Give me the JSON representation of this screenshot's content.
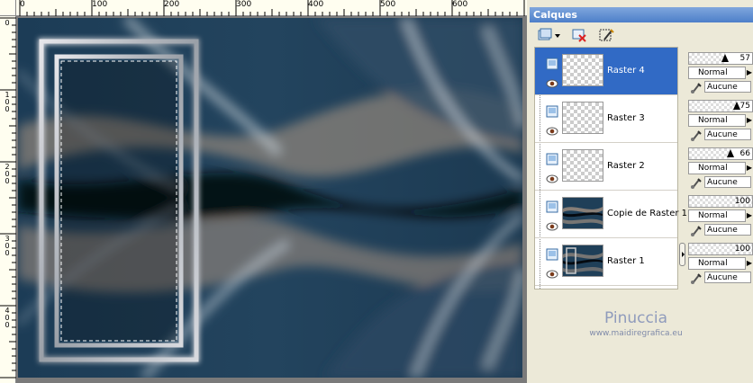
{
  "ruler": {
    "top_labels": [
      "0",
      "100",
      "200",
      "300",
      "400",
      "500",
      "600"
    ],
    "left_labels": [
      "0",
      "100",
      "200",
      "300",
      "400"
    ]
  },
  "panel": {
    "title": "Calques"
  },
  "layers": [
    {
      "name": "Raster 4",
      "selected": true,
      "opacity": "57",
      "opacity_value": 57,
      "blend": "Normal",
      "group": "Aucune"
    },
    {
      "name": "Raster 3",
      "selected": false,
      "opacity": "75",
      "opacity_value": 75,
      "blend": "Normal",
      "group": "Aucune"
    },
    {
      "name": "Raster 2",
      "selected": false,
      "opacity": "66",
      "opacity_value": 66,
      "blend": "Normal",
      "group": "Aucune"
    },
    {
      "name": "Copie de Raster 1",
      "selected": false,
      "opacity": "100",
      "opacity_value": 100,
      "blend": "Normal",
      "group": "Aucune"
    },
    {
      "name": "Raster 1",
      "selected": false,
      "opacity": "100",
      "opacity_value": 100,
      "blend": "Normal",
      "group": "Aucune"
    }
  ],
  "watermark": {
    "name": "Pinuccia",
    "url": "www.maidiregrafica.eu"
  },
  "colors": {
    "selection": "#316ac5",
    "title_bar": "#4d7fc9",
    "panel_bg": "#ece9d8"
  }
}
